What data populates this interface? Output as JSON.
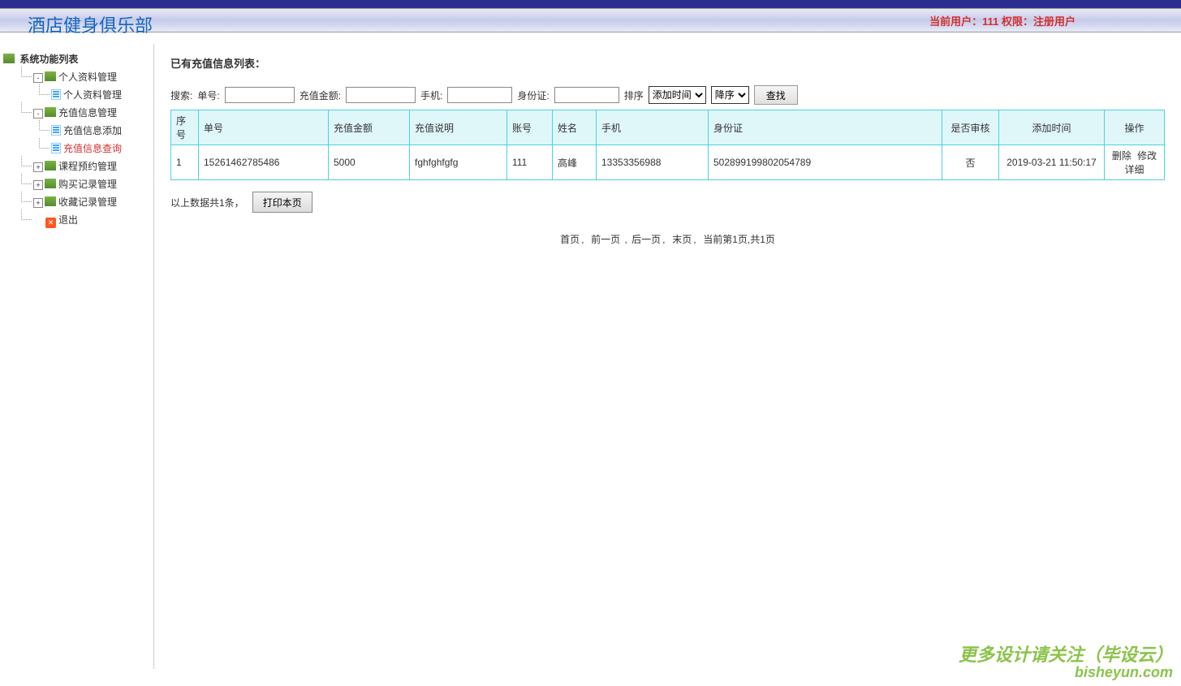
{
  "app_title": "酒店健身俱乐部",
  "user_info": "当前用户：111  权限：注册用户",
  "sidebar": {
    "root_label": "系统功能列表",
    "groups": [
      {
        "label": "个人资料管理",
        "expanded": true,
        "children": [
          {
            "label": "个人资料管理",
            "active": false
          }
        ]
      },
      {
        "label": "充值信息管理",
        "expanded": true,
        "children": [
          {
            "label": "充值信息添加",
            "active": false
          },
          {
            "label": "充值信息查询",
            "active": true
          }
        ]
      },
      {
        "label": "课程预约管理",
        "expanded": false
      },
      {
        "label": "购买记录管理",
        "expanded": false
      },
      {
        "label": "收藏记录管理",
        "expanded": false
      }
    ],
    "exit_label": "退出"
  },
  "main": {
    "list_title": "已有充值信息列表：",
    "search": {
      "label_search": "搜索:",
      "label_order_no": "单号:",
      "label_amount": "充值金额:",
      "label_phone": "手机:",
      "label_idcard": "身份证:",
      "label_sort": "排序",
      "sort_field_selected": "添加时间",
      "sort_dir_selected": "降序",
      "btn_find": "查找"
    },
    "columns": [
      "序号",
      "单号",
      "充值金额",
      "充值说明",
      "账号",
      "姓名",
      "手机",
      "身份证",
      "是否审核",
      "添加时间",
      "操作"
    ],
    "rows": [
      {
        "seq": "1",
        "order_no": "15261462785486",
        "amount": "5000",
        "desc": "fghfghfgfg",
        "account": "111",
        "name": "高峰",
        "phone": "13353356988",
        "idcard": "502899199802054789",
        "audited": "否",
        "add_time": "2019-03-21 11:50:17"
      }
    ],
    "ops": {
      "delete": "删除",
      "edit": "修改",
      "detail": "详细"
    },
    "summary": "以上数据共1条，",
    "print_btn": "打印本页",
    "pager": {
      "first": "首页",
      "prev": "前一页",
      "next": "后一页",
      "last": "末页",
      "status": "当前第1页,共1页"
    }
  },
  "watermark": {
    "line1": "更多设计请关注（毕设云）",
    "line2": "bisheyun.com"
  }
}
